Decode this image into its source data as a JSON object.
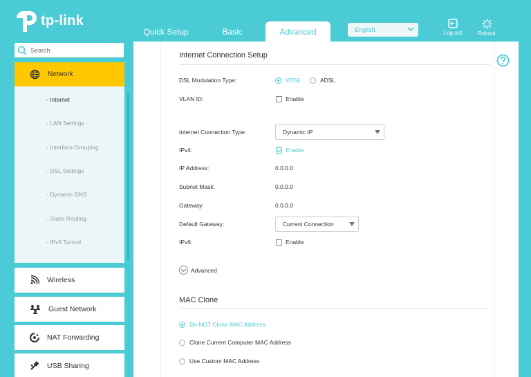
{
  "brand": {
    "logo_text": "tp-link",
    "accent": "#4acbd6",
    "highlight": "#ffc800"
  },
  "header": {
    "tabs": [
      {
        "label": "Quick Setup"
      },
      {
        "label": "Basic"
      },
      {
        "label": "Advanced",
        "active": true
      }
    ],
    "language": "English",
    "logout_label": "Log out",
    "reboot_label": "Reboot"
  },
  "sidebar": {
    "search_placeholder": "Search",
    "network": {
      "label": "Network",
      "icon": "globe-icon",
      "items": [
        {
          "label": "- Internet",
          "active": true
        },
        {
          "label": "- LAN Settings"
        },
        {
          "label": "- Interface Grouping"
        },
        {
          "label": "- DSL Settings"
        },
        {
          "label": "- Dynamic DNS"
        },
        {
          "label": "- Static Routing"
        },
        {
          "label": "- IPv6 Tunnel"
        }
      ]
    },
    "items": [
      {
        "label": "Wireless",
        "icon": "wifi-icon"
      },
      {
        "label": "Guest Network",
        "icon": "guests-icon"
      },
      {
        "label": "NAT Forwarding",
        "icon": "nat-icon"
      },
      {
        "label": "USB Sharing",
        "icon": "usb-icon"
      }
    ]
  },
  "main": {
    "internet_section": {
      "title": "Internet Connection Setup",
      "dsl_label": "DSL Modulation Type:",
      "dsl_options": [
        {
          "label": "VDSL",
          "selected": true
        },
        {
          "label": "ADSL",
          "selected": false
        }
      ],
      "vlan_label": "VLAN ID:",
      "vlan_enable": {
        "label": "Enable",
        "checked": false
      },
      "conn_type_label": "Internet Connection Type:",
      "conn_type_value": "Dynamic IP",
      "ipv4_label": "IPv4:",
      "ipv4_enable": {
        "label": "Enable",
        "checked": true
      },
      "ip_label": "IP Address:",
      "ip_value": "0.0.0.0",
      "subnet_label": "Subnet Mask:",
      "subnet_value": "0.0.0.0",
      "gateway_label": "Gateway:",
      "gateway_value": "0.0.0.0",
      "default_gw_label": "Default Gateway:",
      "default_gw_value": "Current Connection",
      "ipv6_label": "IPv6:",
      "ipv6_enable": {
        "label": "Enable",
        "checked": false
      },
      "advanced_label": "Advanced"
    },
    "mac_section": {
      "title": "MAC Clone",
      "options": [
        {
          "label": "Do NOT Clone MAC Address",
          "selected": true
        },
        {
          "label": "Clone Current Computer MAC Address",
          "selected": false
        },
        {
          "label": "Use Custom MAC Address",
          "selected": false
        }
      ]
    }
  }
}
